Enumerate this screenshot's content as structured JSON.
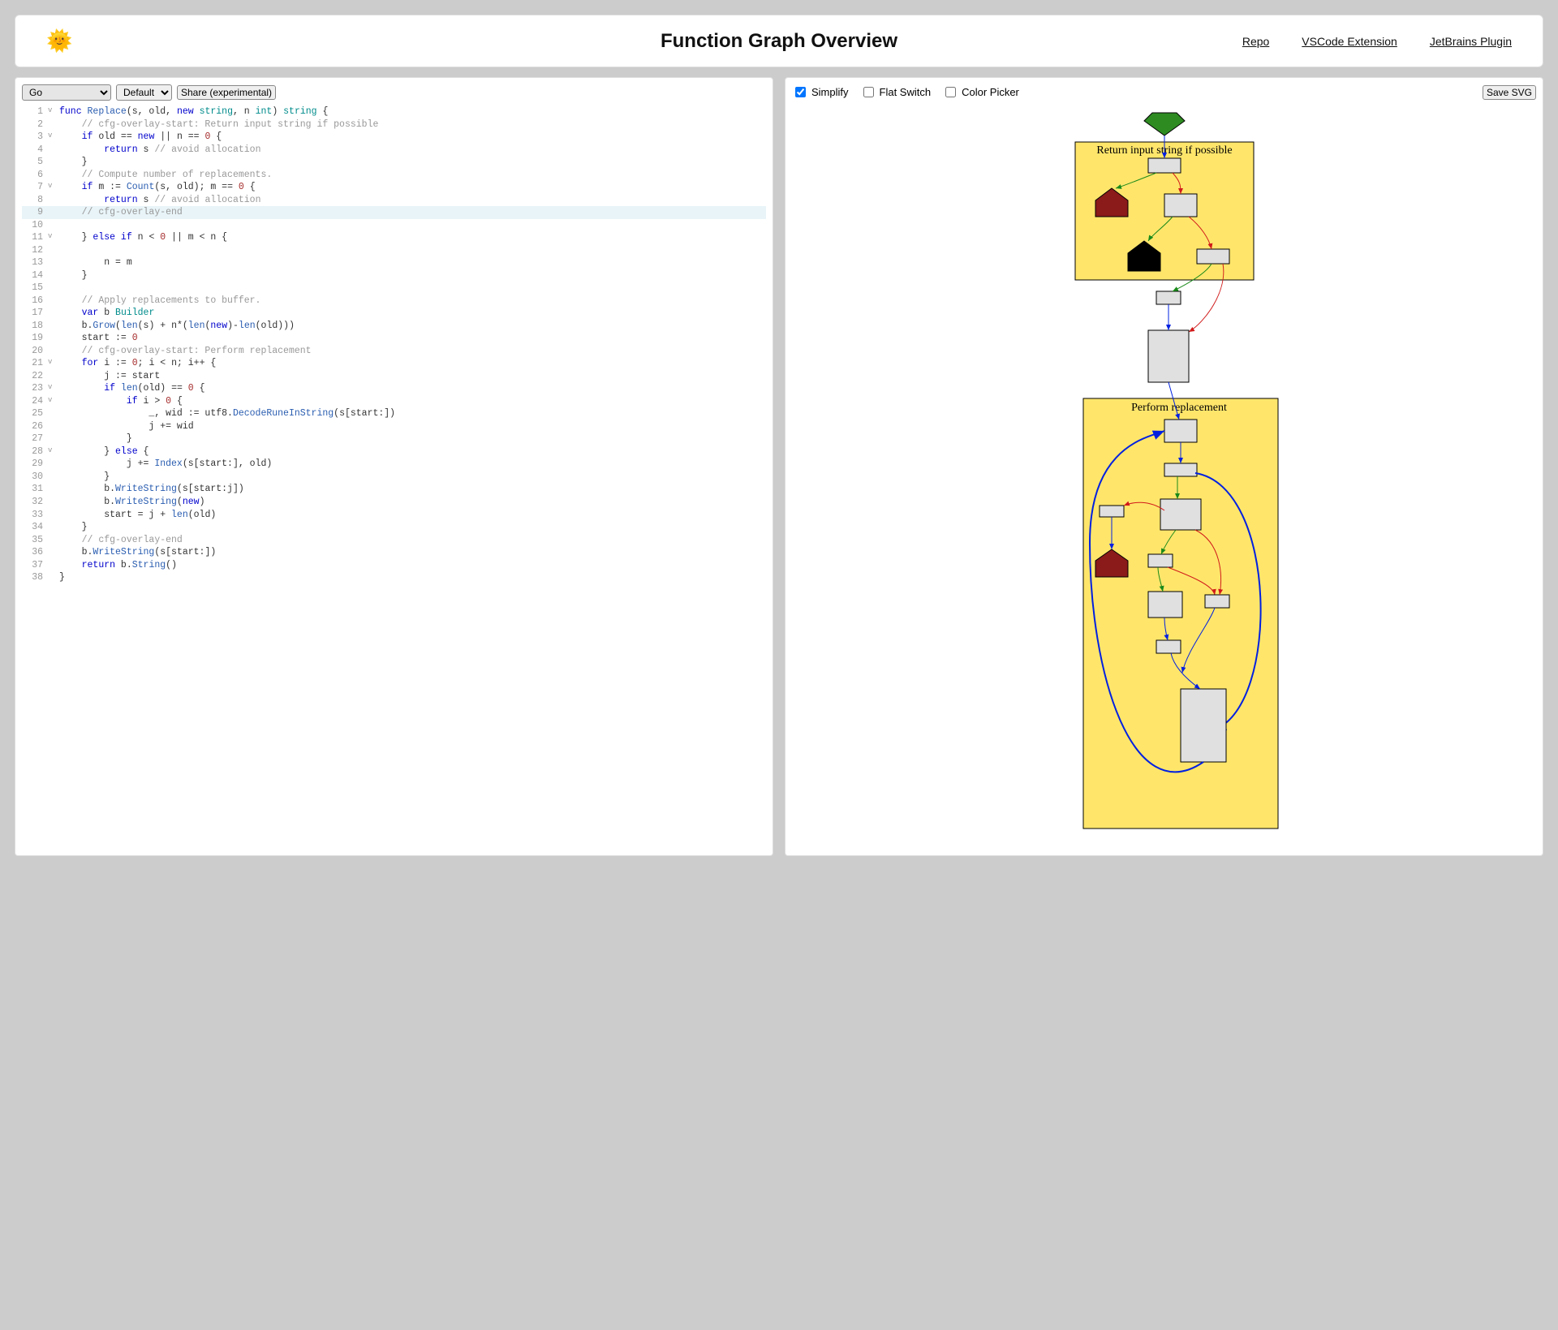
{
  "header": {
    "logo": "🌞",
    "title": "Function Graph Overview",
    "links": {
      "repo": "Repo",
      "vscode": "VSCode Extension",
      "jetbrains": "JetBrains Plugin"
    }
  },
  "editor_controls": {
    "language": "Go",
    "theme": "Default",
    "share": "Share (experimental)"
  },
  "graph_controls": {
    "simplify": {
      "label": "Simplify",
      "checked": true
    },
    "flat_switch": {
      "label": "Flat Switch",
      "checked": false
    },
    "color_picker": {
      "label": "Color Picker",
      "checked": false
    },
    "save_svg": "Save SVG"
  },
  "code": [
    {
      "n": 1,
      "fold": "v",
      "hl": false,
      "html": "<span class='t-kw'>func</span> <span class='t-fn'>Replace</span>(s, old, <span class='t-kw'>new</span> <span class='t-type'>string</span>, n <span class='t-type'>int</span>) <span class='t-type'>string</span> {"
    },
    {
      "n": 2,
      "fold": "",
      "hl": false,
      "html": "    <span class='t-comm'>// cfg-overlay-start: Return input string if possible</span>"
    },
    {
      "n": 3,
      "fold": "v",
      "hl": false,
      "html": "    <span class='t-kw'>if</span> old == <span class='t-kw'>new</span> || n == <span class='t-num'>0</span> {"
    },
    {
      "n": 4,
      "fold": "",
      "hl": false,
      "html": "        <span class='t-kw'>return</span> s <span class='t-comm'>// avoid allocation</span>"
    },
    {
      "n": 5,
      "fold": "",
      "hl": false,
      "html": "    }"
    },
    {
      "n": 6,
      "fold": "",
      "hl": false,
      "html": "    <span class='t-comm'>// Compute number of replacements.</span>"
    },
    {
      "n": 7,
      "fold": "v",
      "hl": false,
      "html": "    <span class='t-kw'>if</span> m := <span class='t-fn'>Count</span>(s, old); m == <span class='t-num'>0</span> {"
    },
    {
      "n": 8,
      "fold": "",
      "hl": false,
      "html": "        <span class='t-kw'>return</span> s <span class='t-comm'>// avoid allocation</span>"
    },
    {
      "n": 9,
      "fold": "",
      "hl": true,
      "html": "    <span class='t-comm'>// cfg-overlay-end</span>"
    },
    {
      "n": 10,
      "fold": "",
      "hl": false,
      "html": ""
    },
    {
      "n": 11,
      "fold": "v",
      "hl": false,
      "html": "    } <span class='t-kw'>else if</span> n &lt; <span class='t-num'>0</span> || m &lt; n {"
    },
    {
      "n": 12,
      "fold": "",
      "hl": false,
      "html": ""
    },
    {
      "n": 13,
      "fold": "",
      "hl": false,
      "html": "        n = m"
    },
    {
      "n": 14,
      "fold": "",
      "hl": false,
      "html": "    }"
    },
    {
      "n": 15,
      "fold": "",
      "hl": false,
      "html": ""
    },
    {
      "n": 16,
      "fold": "",
      "hl": false,
      "html": "    <span class='t-comm'>// Apply replacements to buffer.</span>"
    },
    {
      "n": 17,
      "fold": "",
      "hl": false,
      "html": "    <span class='t-kw'>var</span> b <span class='t-type'>Builder</span>"
    },
    {
      "n": 18,
      "fold": "",
      "hl": false,
      "html": "    b.<span class='t-fn'>Grow</span>(<span class='t-fn'>len</span>(s) + n*(<span class='t-fn'>len</span>(<span class='t-kw'>new</span>)-<span class='t-fn'>len</span>(old)))"
    },
    {
      "n": 19,
      "fold": "",
      "hl": false,
      "html": "    start := <span class='t-num'>0</span>"
    },
    {
      "n": 20,
      "fold": "",
      "hl": false,
      "html": "    <span class='t-comm'>// cfg-overlay-start: Perform replacement</span>"
    },
    {
      "n": 21,
      "fold": "v",
      "hl": false,
      "html": "    <span class='t-kw'>for</span> i := <span class='t-num'>0</span>; i &lt; n; i++ {"
    },
    {
      "n": 22,
      "fold": "",
      "hl": false,
      "html": "        j := start"
    },
    {
      "n": 23,
      "fold": "v",
      "hl": false,
      "html": "        <span class='t-kw'>if</span> <span class='t-fn'>len</span>(old) == <span class='t-num'>0</span> {"
    },
    {
      "n": 24,
      "fold": "v",
      "hl": false,
      "html": "            <span class='t-kw'>if</span> i &gt; <span class='t-num'>0</span> {"
    },
    {
      "n": 25,
      "fold": "",
      "hl": false,
      "html": "                _, wid := utf8.<span class='t-fn'>DecodeRuneInString</span>(s[start:])"
    },
    {
      "n": 26,
      "fold": "",
      "hl": false,
      "html": "                j += wid"
    },
    {
      "n": 27,
      "fold": "",
      "hl": false,
      "html": "            }"
    },
    {
      "n": 28,
      "fold": "v",
      "hl": false,
      "html": "        } <span class='t-kw'>else</span> {"
    },
    {
      "n": 29,
      "fold": "",
      "hl": false,
      "html": "            j += <span class='t-fn'>Index</span>(s[start:], old)"
    },
    {
      "n": 30,
      "fold": "",
      "hl": false,
      "html": "        }"
    },
    {
      "n": 31,
      "fold": "",
      "hl": false,
      "html": "        b.<span class='t-fn'>WriteString</span>(s[start:j])"
    },
    {
      "n": 32,
      "fold": "",
      "hl": false,
      "html": "        b.<span class='t-fn'>WriteString</span>(<span class='t-kw'>new</span>)"
    },
    {
      "n": 33,
      "fold": "",
      "hl": false,
      "html": "        start = j + <span class='t-fn'>len</span>(old)"
    },
    {
      "n": 34,
      "fold": "",
      "hl": false,
      "html": "    }"
    },
    {
      "n": 35,
      "fold": "",
      "hl": false,
      "html": "    <span class='t-comm'>// cfg-overlay-end</span>"
    },
    {
      "n": 36,
      "fold": "",
      "hl": false,
      "html": "    b.<span class='t-fn'>WriteString</span>(s[start:])"
    },
    {
      "n": 37,
      "fold": "",
      "hl": false,
      "html": "    <span class='t-kw'>return</span> b.<span class='t-fn'>String</span>()"
    },
    {
      "n": 38,
      "fold": "",
      "hl": false,
      "html": "}"
    }
  ],
  "graph": {
    "overlay1": "Return input string if possible",
    "overlay2": "Perform replacement",
    "colors": {
      "overlay_fill": "#ffe66b",
      "node_fill": "#e0e0e0",
      "node_stroke": "#000000",
      "entry_fill": "#2e8b22",
      "return_fill": "#8b1a1a",
      "return_fill2": "#000000",
      "edge_true": "#1a8a1a",
      "edge_false": "#d11a1a",
      "edge_seq": "#0020e0"
    }
  }
}
